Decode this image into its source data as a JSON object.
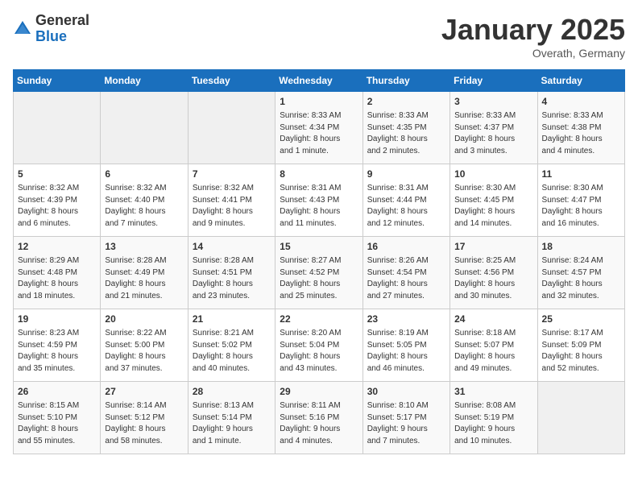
{
  "logo": {
    "general": "General",
    "blue": "Blue"
  },
  "title": "January 2025",
  "subtitle": "Overath, Germany",
  "weekdays": [
    "Sunday",
    "Monday",
    "Tuesday",
    "Wednesday",
    "Thursday",
    "Friday",
    "Saturday"
  ],
  "weeks": [
    [
      {
        "day": "",
        "detail": ""
      },
      {
        "day": "",
        "detail": ""
      },
      {
        "day": "",
        "detail": ""
      },
      {
        "day": "1",
        "detail": "Sunrise: 8:33 AM\nSunset: 4:34 PM\nDaylight: 8 hours\nand 1 minute."
      },
      {
        "day": "2",
        "detail": "Sunrise: 8:33 AM\nSunset: 4:35 PM\nDaylight: 8 hours\nand 2 minutes."
      },
      {
        "day": "3",
        "detail": "Sunrise: 8:33 AM\nSunset: 4:37 PM\nDaylight: 8 hours\nand 3 minutes."
      },
      {
        "day": "4",
        "detail": "Sunrise: 8:33 AM\nSunset: 4:38 PM\nDaylight: 8 hours\nand 4 minutes."
      }
    ],
    [
      {
        "day": "5",
        "detail": "Sunrise: 8:32 AM\nSunset: 4:39 PM\nDaylight: 8 hours\nand 6 minutes."
      },
      {
        "day": "6",
        "detail": "Sunrise: 8:32 AM\nSunset: 4:40 PM\nDaylight: 8 hours\nand 7 minutes."
      },
      {
        "day": "7",
        "detail": "Sunrise: 8:32 AM\nSunset: 4:41 PM\nDaylight: 8 hours\nand 9 minutes."
      },
      {
        "day": "8",
        "detail": "Sunrise: 8:31 AM\nSunset: 4:43 PM\nDaylight: 8 hours\nand 11 minutes."
      },
      {
        "day": "9",
        "detail": "Sunrise: 8:31 AM\nSunset: 4:44 PM\nDaylight: 8 hours\nand 12 minutes."
      },
      {
        "day": "10",
        "detail": "Sunrise: 8:30 AM\nSunset: 4:45 PM\nDaylight: 8 hours\nand 14 minutes."
      },
      {
        "day": "11",
        "detail": "Sunrise: 8:30 AM\nSunset: 4:47 PM\nDaylight: 8 hours\nand 16 minutes."
      }
    ],
    [
      {
        "day": "12",
        "detail": "Sunrise: 8:29 AM\nSunset: 4:48 PM\nDaylight: 8 hours\nand 18 minutes."
      },
      {
        "day": "13",
        "detail": "Sunrise: 8:28 AM\nSunset: 4:49 PM\nDaylight: 8 hours\nand 21 minutes."
      },
      {
        "day": "14",
        "detail": "Sunrise: 8:28 AM\nSunset: 4:51 PM\nDaylight: 8 hours\nand 23 minutes."
      },
      {
        "day": "15",
        "detail": "Sunrise: 8:27 AM\nSunset: 4:52 PM\nDaylight: 8 hours\nand 25 minutes."
      },
      {
        "day": "16",
        "detail": "Sunrise: 8:26 AM\nSunset: 4:54 PM\nDaylight: 8 hours\nand 27 minutes."
      },
      {
        "day": "17",
        "detail": "Sunrise: 8:25 AM\nSunset: 4:56 PM\nDaylight: 8 hours\nand 30 minutes."
      },
      {
        "day": "18",
        "detail": "Sunrise: 8:24 AM\nSunset: 4:57 PM\nDaylight: 8 hours\nand 32 minutes."
      }
    ],
    [
      {
        "day": "19",
        "detail": "Sunrise: 8:23 AM\nSunset: 4:59 PM\nDaylight: 8 hours\nand 35 minutes."
      },
      {
        "day": "20",
        "detail": "Sunrise: 8:22 AM\nSunset: 5:00 PM\nDaylight: 8 hours\nand 37 minutes."
      },
      {
        "day": "21",
        "detail": "Sunrise: 8:21 AM\nSunset: 5:02 PM\nDaylight: 8 hours\nand 40 minutes."
      },
      {
        "day": "22",
        "detail": "Sunrise: 8:20 AM\nSunset: 5:04 PM\nDaylight: 8 hours\nand 43 minutes."
      },
      {
        "day": "23",
        "detail": "Sunrise: 8:19 AM\nSunset: 5:05 PM\nDaylight: 8 hours\nand 46 minutes."
      },
      {
        "day": "24",
        "detail": "Sunrise: 8:18 AM\nSunset: 5:07 PM\nDaylight: 8 hours\nand 49 minutes."
      },
      {
        "day": "25",
        "detail": "Sunrise: 8:17 AM\nSunset: 5:09 PM\nDaylight: 8 hours\nand 52 minutes."
      }
    ],
    [
      {
        "day": "26",
        "detail": "Sunrise: 8:15 AM\nSunset: 5:10 PM\nDaylight: 8 hours\nand 55 minutes."
      },
      {
        "day": "27",
        "detail": "Sunrise: 8:14 AM\nSunset: 5:12 PM\nDaylight: 8 hours\nand 58 minutes."
      },
      {
        "day": "28",
        "detail": "Sunrise: 8:13 AM\nSunset: 5:14 PM\nDaylight: 9 hours\nand 1 minute."
      },
      {
        "day": "29",
        "detail": "Sunrise: 8:11 AM\nSunset: 5:16 PM\nDaylight: 9 hours\nand 4 minutes."
      },
      {
        "day": "30",
        "detail": "Sunrise: 8:10 AM\nSunset: 5:17 PM\nDaylight: 9 hours\nand 7 minutes."
      },
      {
        "day": "31",
        "detail": "Sunrise: 8:08 AM\nSunset: 5:19 PM\nDaylight: 9 hours\nand 10 minutes."
      },
      {
        "day": "",
        "detail": ""
      }
    ]
  ]
}
